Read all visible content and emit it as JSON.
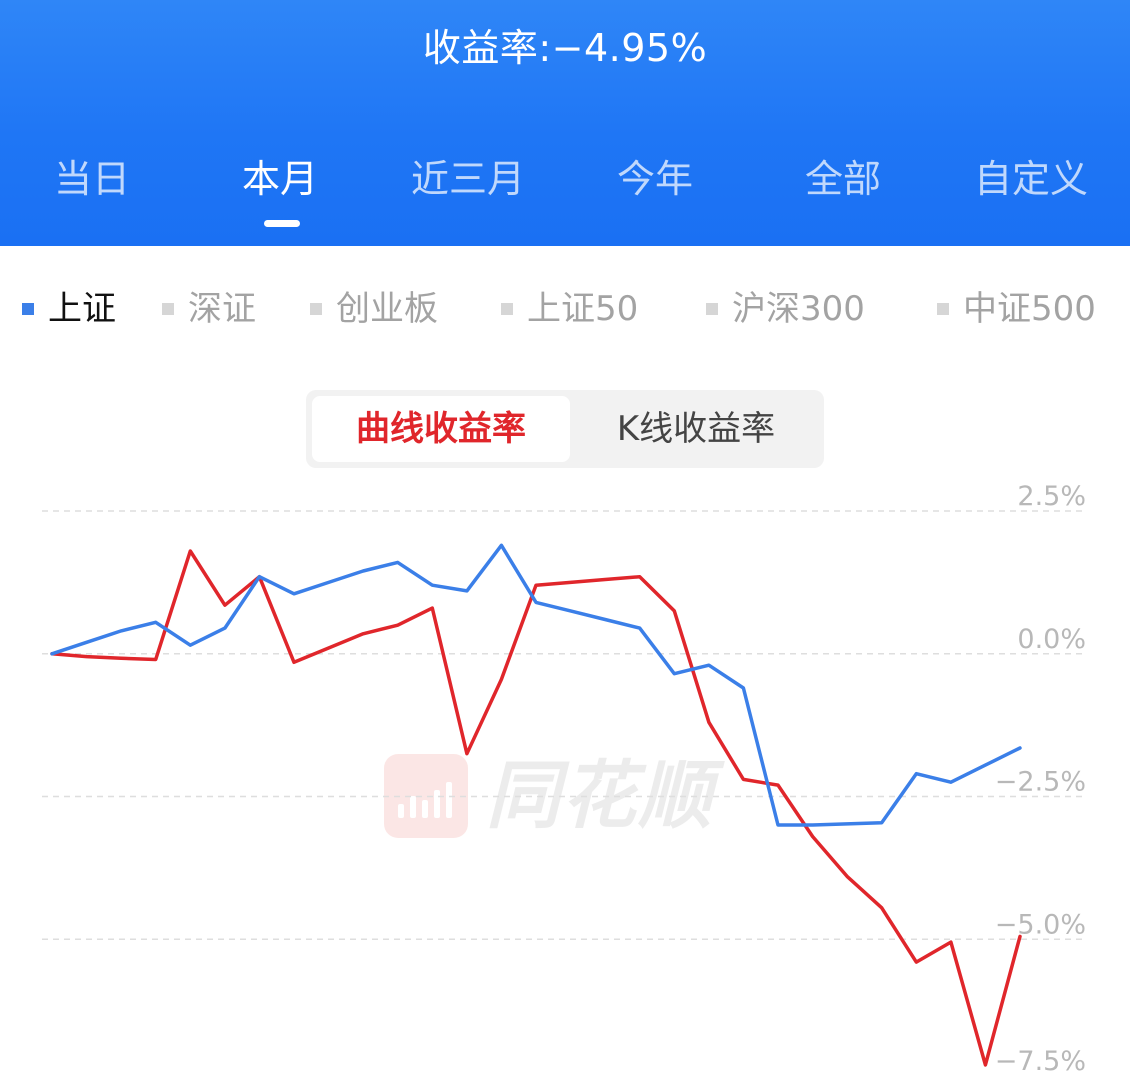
{
  "header": {
    "title": "收益率:−4.95%",
    "tabs": [
      "当日",
      "本月",
      "近三月",
      "今年",
      "全部",
      "自定义"
    ],
    "active_tab": "本月"
  },
  "indices": {
    "items": [
      "上证",
      "深证",
      "创业板",
      "上证50",
      "沪深300",
      "中证500"
    ],
    "active": "上证"
  },
  "toggle": {
    "curve_label": "曲线收益率",
    "kline_label": "K线收益率",
    "active": "曲线收益率"
  },
  "watermark": {
    "text": "同花顺"
  },
  "colors": {
    "header": "#1f76f5",
    "portfolio_line": "#e0262b",
    "index_line": "#3b7fe8",
    "active_index_marker": "#3b7fe8",
    "active_toggle_text": "#e0262b"
  },
  "chart_data": {
    "type": "line",
    "ylim": [
      -7.5,
      2.5
    ],
    "yticks": [
      2.5,
      0.0,
      -2.5,
      -5.0,
      -7.5
    ],
    "ytick_labels": [
      "2.5%",
      "0.0%",
      "−2.5%",
      "−5.0%",
      "−7.5%"
    ],
    "grid": true,
    "x": [
      1,
      2,
      3,
      4,
      5,
      6,
      7,
      8,
      9,
      10,
      11,
      12,
      13,
      14,
      15,
      16,
      17,
      18,
      19,
      20,
      21,
      22,
      23,
      24,
      25,
      26,
      27,
      28,
      29
    ],
    "series": [
      {
        "color": "#e0262b",
        "values": [
          0.0,
          -0.05,
          -0.08,
          -0.1,
          1.8,
          0.85,
          1.35,
          -0.15,
          0.1,
          0.35,
          0.5,
          0.8,
          -1.75,
          -0.45,
          1.2,
          1.25,
          1.3,
          1.35,
          0.75,
          -1.2,
          -2.2,
          -2.3,
          -3.2,
          -3.9,
          -4.45,
          -5.4,
          -5.05,
          -7.2,
          -4.95
        ]
      },
      {
        "color": "#3b7fe8",
        "values": [
          0.0,
          0.2,
          0.4,
          0.55,
          0.15,
          0.45,
          1.35,
          1.05,
          1.25,
          1.45,
          1.6,
          1.2,
          1.1,
          1.9,
          0.9,
          0.75,
          0.6,
          0.45,
          -0.35,
          -0.2,
          -0.6,
          -3.0,
          -3.0,
          -2.98,
          -2.96,
          -2.1,
          -2.25,
          -1.95,
          -1.65
        ]
      }
    ]
  }
}
